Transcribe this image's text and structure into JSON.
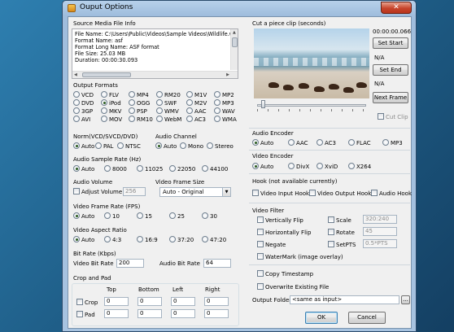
{
  "window": {
    "title": "Ouput Options",
    "close": "✕"
  },
  "source": {
    "label": "Source Media File Info",
    "lines": [
      "File Name: C:\\Users\\Public\\Videos\\Sample Videos\\Wildlife.wm",
      "Format Name: asf",
      "Format Long Name: ASF format",
      "File Size: 25.03 MB",
      "Duration: 00:00:30.093"
    ],
    "scroll_icon": "scroll-arrow-icons"
  },
  "clip": {
    "label": "Cut a piece clip (seconds)",
    "time": "00:00:00.066",
    "set_start": "Set Start",
    "start_val": "N/A",
    "set_end": "Set End",
    "end_val": "N/A",
    "next_frame": "Next Frame",
    "cut_clip": "Cut Clip"
  },
  "formats": {
    "label": "Output Formats",
    "items": [
      "VCD",
      "FLV",
      "MP4",
      "RM20",
      "M1V",
      "MP2",
      "DVD",
      "iPod",
      "OGG",
      "SWF",
      "M2V",
      "MP3",
      "3GP",
      "MKV",
      "PSP",
      "WMV",
      "AAC",
      "WAV",
      "AVI",
      "MOV",
      "RM10",
      "WebM",
      "AC3",
      "WMA"
    ],
    "selected": "iPod"
  },
  "norm": {
    "label": "Norm(VCD/SVCD/DVD)",
    "options": [
      "Auto",
      "PAL",
      "NTSC"
    ]
  },
  "channel": {
    "label": "Audio Channel",
    "options": [
      "Auto",
      "Mono",
      "Stereo"
    ]
  },
  "sample_rate": {
    "label": "Audio Sample Rate (Hz)",
    "options": [
      "Auto",
      "8000",
      "11025",
      "22050",
      "44100"
    ]
  },
  "volume": {
    "label": "Audio Volume",
    "adjust": "Adjust Volume",
    "value": "256"
  },
  "frame_size": {
    "label": "Video Frame Size",
    "value": "Auto - Original"
  },
  "frame_rate": {
    "label": "Video Frame Rate (FPS)",
    "options": [
      "Auto",
      "10",
      "15",
      "25",
      "30"
    ]
  },
  "aspect": {
    "label": "Video Aspect Ratio",
    "options": [
      "Auto",
      "4:3",
      "16:9",
      "37:20",
      "47:20"
    ]
  },
  "bitrate": {
    "label": "Bit Rate (Kbps)",
    "video_label": "Video Bit Rate",
    "video_value": "200",
    "audio_label": "Audio Bit Rate",
    "audio_value": "64"
  },
  "crop": {
    "label": "Crop and Pad",
    "cols": [
      "Top",
      "Bottom",
      "Left",
      "Right"
    ],
    "crop_label": "Crop",
    "pad_label": "Pad",
    "crop_values": [
      "0",
      "0",
      "0",
      "0"
    ],
    "pad_values": [
      "0",
      "0",
      "0",
      "0"
    ]
  },
  "audio_encoder": {
    "label": "Audio Encoder",
    "options": [
      "Auto",
      "AAC",
      "AC3",
      "FLAC",
      "MP3"
    ]
  },
  "video_encoder": {
    "label": "Video Encoder",
    "options": [
      "Auto",
      "DivX",
      "XviD",
      "X264"
    ]
  },
  "hook": {
    "label": "Hook (not available currently)",
    "items": [
      "Video Input Hook",
      "Video Output Hook",
      "Audio Hook"
    ]
  },
  "filter": {
    "label": "Video Filter",
    "vflip": "Vertically Flip",
    "hflip": "Horizontally Flip",
    "negate": "Negate",
    "watermark": "WaterMark (image overlay)",
    "scale": "Scale",
    "scale_value": "320:240",
    "rotate": "Rotate",
    "rotate_value": "45",
    "setpts": "SetPTS",
    "setpts_value": "0.5*PTS"
  },
  "misc": {
    "copy_ts": "Copy Timestamp",
    "overwrite": "Overwrite Existing File",
    "folder_label": "Output Folder",
    "folder_value": "<same as input>",
    "browse": "..."
  },
  "footer": {
    "ok": "OK",
    "cancel": "Cancel"
  }
}
